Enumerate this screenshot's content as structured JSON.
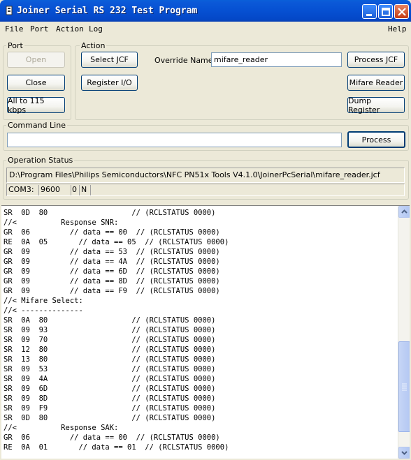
{
  "window": {
    "title": "Joiner Serial RS 232 Test Program"
  },
  "menu": {
    "items": [
      "File",
      "Port",
      "Action",
      "Log"
    ],
    "help": "Help"
  },
  "port": {
    "label": "Port",
    "open": "Open",
    "close": "Close",
    "all115": "All to 115 kbps"
  },
  "action": {
    "label": "Action",
    "select_jcf": "Select JCF",
    "register_io": "Register I/O",
    "override_label": "Override Name:",
    "override_value": "mifare_reader",
    "process_jcf": "Process JCF",
    "mifare_reader": "Mifare Reader",
    "dump_register": "Dump Register"
  },
  "command": {
    "label": "Command Line",
    "value": "",
    "process": "Process"
  },
  "operation": {
    "label": "Operation Status",
    "path": "D:\\Program Files\\Philips Semiconductors\\NFC PN51x Tools V4.1.0\\JoinerPcSerial\\mifare_reader.jcf",
    "port": "COM3:",
    "baud": "9600",
    "flag1": "0",
    "flag2": "N"
  },
  "log": {
    "lines": [
      "SR  0D  80                   // (RCLSTATUS 0000)",
      "//<          Response SNR:",
      "GR  06         // data == 00  // (RCLSTATUS 0000)",
      "RE  0A  05       // data == 05  // (RCLSTATUS 0000)",
      "GR  09         // data == 53  // (RCLSTATUS 0000)",
      "GR  09         // data == 4A  // (RCLSTATUS 0000)",
      "GR  09         // data == 6D  // (RCLSTATUS 0000)",
      "GR  09         // data == 8D  // (RCLSTATUS 0000)",
      "GR  09         // data == F9  // (RCLSTATUS 0000)",
      "//< Mifare Select:",
      "//< --------------",
      "SR  0A  80                   // (RCLSTATUS 0000)",
      "SR  09  93                   // (RCLSTATUS 0000)",
      "SR  09  70                   // (RCLSTATUS 0000)",
      "SR  12  80                   // (RCLSTATUS 0000)",
      "SR  13  80                   // (RCLSTATUS 0000)",
      "SR  09  53                   // (RCLSTATUS 0000)",
      "SR  09  4A                   // (RCLSTATUS 0000)",
      "SR  09  6D                   // (RCLSTATUS 0000)",
      "SR  09  8D                   // (RCLSTATUS 0000)",
      "SR  09  F9                   // (RCLSTATUS 0000)",
      "SR  0D  80                   // (RCLSTATUS 0000)",
      "//<          Response SAK:",
      "GR  06         // data == 00  // (RCLSTATUS 0000)",
      "RE  0A  01       // data == 01  // (RCLSTATUS 0000)"
    ]
  },
  "colors": {
    "titlebar": "#0650d2",
    "window_bg": "#ece9d8",
    "button_border": "#003c74"
  }
}
